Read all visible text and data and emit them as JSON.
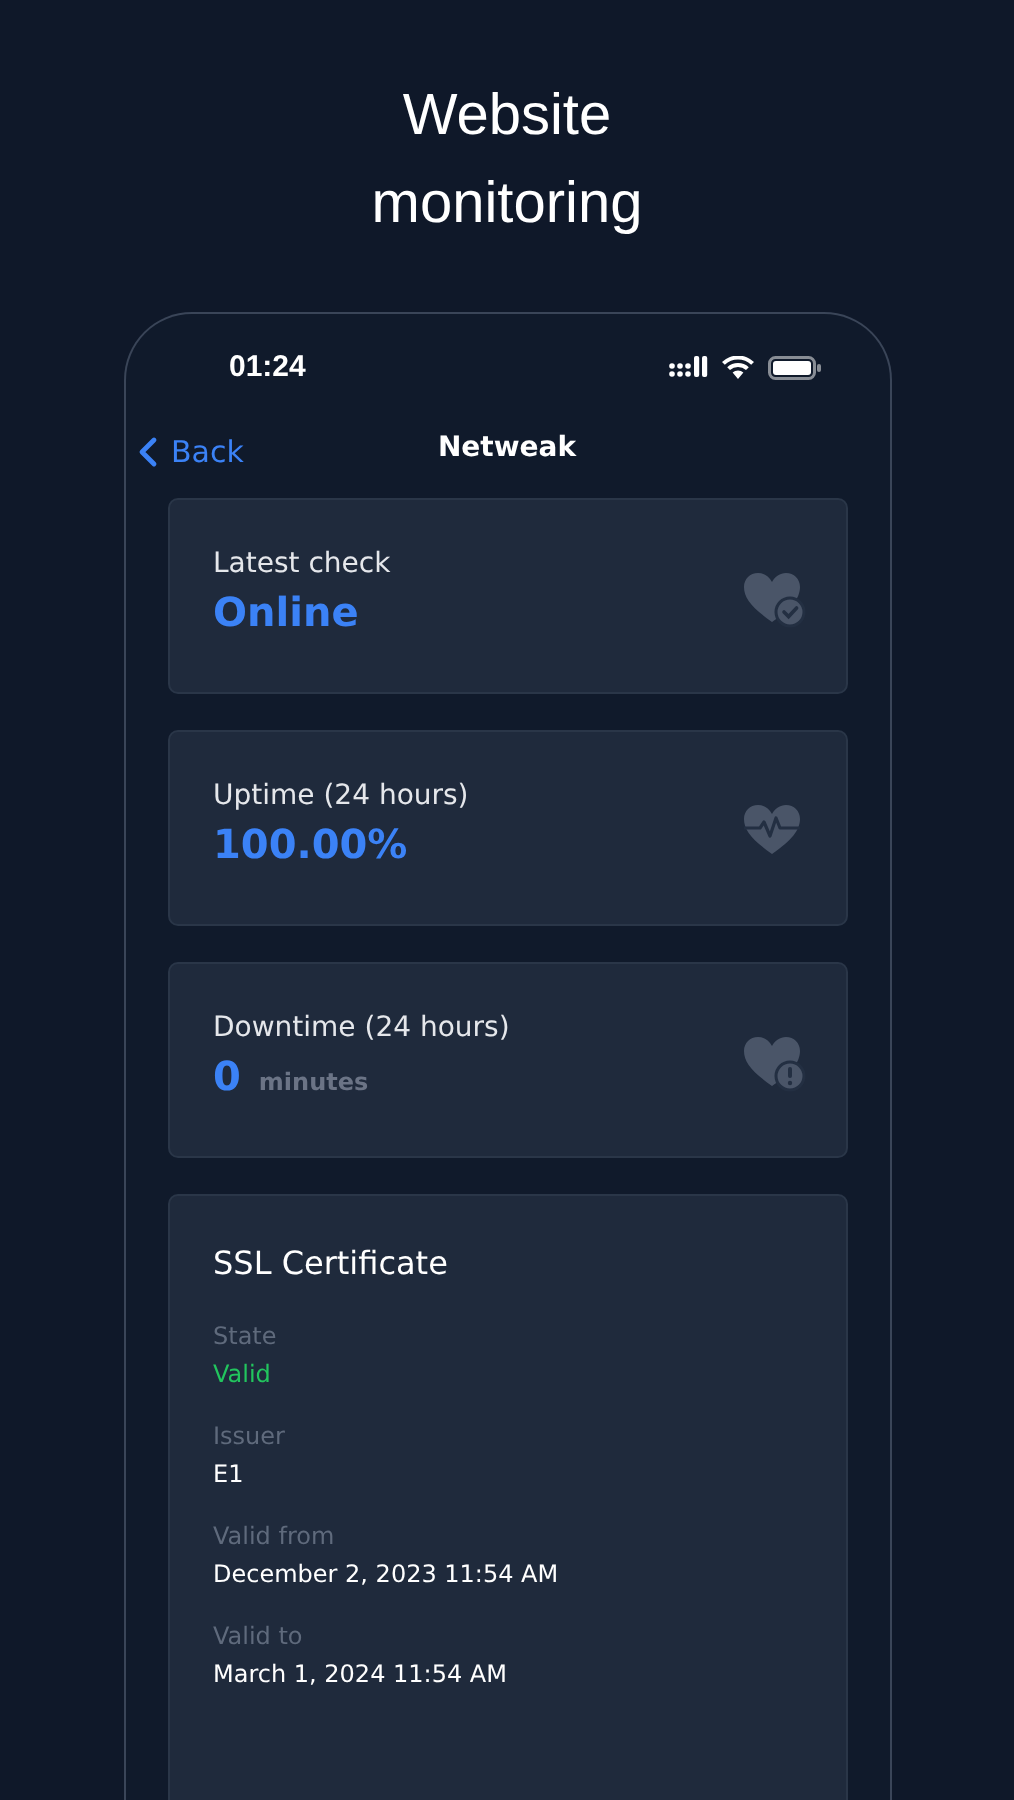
{
  "headline": "Website monitoring",
  "status_bar": {
    "time": "01:24"
  },
  "nav": {
    "back": "Back",
    "title": "Netweak"
  },
  "stats": [
    {
      "label": "Latest check",
      "value": "Online",
      "kind": "check"
    },
    {
      "label": "Uptime (24 hours)",
      "value": "100.00%",
      "kind": "pulse"
    },
    {
      "label": "Downtime (24 hours)",
      "value": "0",
      "unit": "minutes",
      "kind": "alert"
    }
  ],
  "ssl": {
    "title": "SSL Certificate",
    "fields": [
      {
        "label": "State",
        "value": "Valid",
        "kind": "status"
      },
      {
        "label": "Issuer",
        "value": "E1",
        "kind": "text"
      },
      {
        "label": "Valid from",
        "value": "December 2, 2023 11:54 AM",
        "kind": "text"
      },
      {
        "label": "Valid to",
        "value": "March 1, 2024 11:54 AM",
        "kind": "text"
      }
    ]
  }
}
